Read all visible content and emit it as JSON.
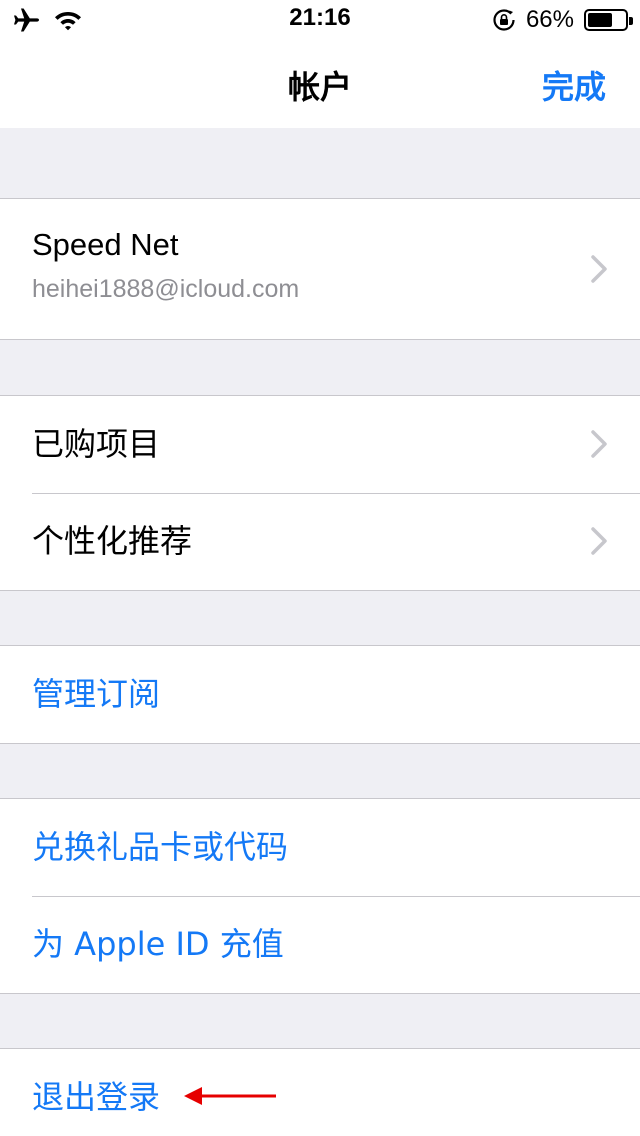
{
  "status_bar": {
    "time": "21:16",
    "battery_percent": "66%",
    "battery_level": 0.66,
    "icons": [
      "airplane-icon",
      "wifi-icon",
      "rotation-lock-icon",
      "battery-icon"
    ]
  },
  "nav": {
    "title": "帐户",
    "done_label": "完成"
  },
  "account": {
    "name": "Speed Net",
    "email": "heihei1888@icloud.com"
  },
  "menu": {
    "purchased": "已购项目",
    "personalized": "个性化推荐",
    "subscriptions": "管理订阅",
    "redeem": "兑换礼品卡或代码",
    "add_funds": "为 Apple ID 充值",
    "sign_out": "退出登录"
  },
  "colors": {
    "accent": "#1479f6",
    "background": "#efeff4",
    "separator": "#c8c7cc",
    "secondary_text": "#8e8e93",
    "annotation_arrow": "#e60000"
  }
}
